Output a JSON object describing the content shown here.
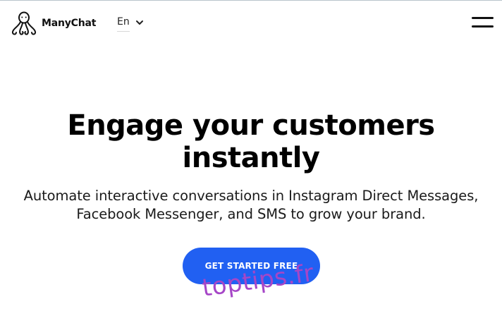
{
  "header": {
    "brand_name": "ManyChat",
    "logo_icon": "octopus-logo-icon",
    "language": "En",
    "language_icon": "chevron-down-icon",
    "menu_icon": "hamburger-menu-icon"
  },
  "hero": {
    "title_line1": "Engage your customers",
    "title_line2": "instantly",
    "subtitle_line1": "Automate interactive conversations in Instagram Direct Messages,",
    "subtitle_line2": "Facebook Messenger, and SMS to grow your brand.",
    "cta_label": "GET STARTED FREE"
  },
  "watermark": {
    "text": "toptips.fr"
  },
  "colors": {
    "accent": "#2160f2",
    "watermark": "#a646c7",
    "text": "#000000",
    "background": "#ffffff"
  }
}
